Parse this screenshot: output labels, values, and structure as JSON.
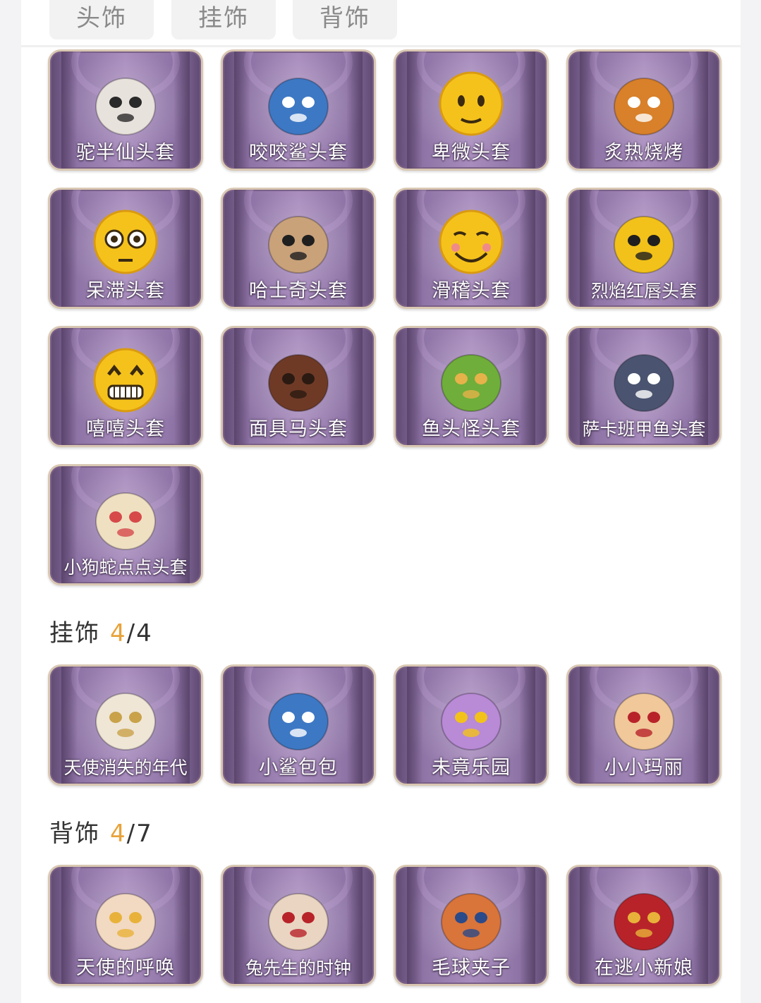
{
  "tabs": [
    "头饰",
    "挂饰",
    "背饰"
  ],
  "headgear": {
    "items": [
      {
        "label": "驼半仙头套",
        "icon": "raccoon-mask-icon"
      },
      {
        "label": "咬咬鲨头套",
        "icon": "shark-mask-icon"
      },
      {
        "label": "卑微头套",
        "icon": "humble-face-mask-icon"
      },
      {
        "label": "炙热烧烤",
        "icon": "bbq-mask-icon"
      },
      {
        "label": "呆滞头套",
        "icon": "dazed-face-mask-icon"
      },
      {
        "label": "哈士奇头套",
        "icon": "husky-mask-icon"
      },
      {
        "label": "滑稽头套",
        "icon": "funny-face-mask-icon"
      },
      {
        "label": "烈焰红唇头套",
        "icon": "pikachu-mask-icon"
      },
      {
        "label": "嘻嘻头套",
        "icon": "grin-face-mask-icon"
      },
      {
        "label": "面具马头套",
        "icon": "horse-mask-icon"
      },
      {
        "label": "鱼头怪头套",
        "icon": "fish-head-mask-icon"
      },
      {
        "label": "萨卡班甲鱼头套",
        "icon": "sacabambaspis-mask-icon"
      },
      {
        "label": "小狗蛇点点头套",
        "icon": "snake-mask-icon"
      }
    ]
  },
  "pendant": {
    "title": "挂饰",
    "owned": "4",
    "total": "/4",
    "items": [
      {
        "label": "天使消失的年代",
        "icon": "angel-doll-icon"
      },
      {
        "label": "小鲨包包",
        "icon": "shark-bag-icon"
      },
      {
        "label": "未竟乐园",
        "icon": "clown-doll-icon"
      },
      {
        "label": "小小玛丽",
        "icon": "mary-doll-icon"
      }
    ]
  },
  "back": {
    "title": "背饰",
    "owned": "4",
    "total": "/7",
    "items": [
      {
        "label": "天使的呼唤",
        "icon": "cupid-doll-icon"
      },
      {
        "label": "兔先生的时钟",
        "icon": "rabbit-clock-icon"
      },
      {
        "label": "毛球夹子",
        "icon": "raccoon-clip-icon"
      },
      {
        "label": "在逃小新娘",
        "icon": "red-dress-icon"
      }
    ]
  },
  "colors": {
    "accent": "#e8a33a",
    "card_border": "#d9c7b2",
    "card_bg": "#a88cbd"
  }
}
